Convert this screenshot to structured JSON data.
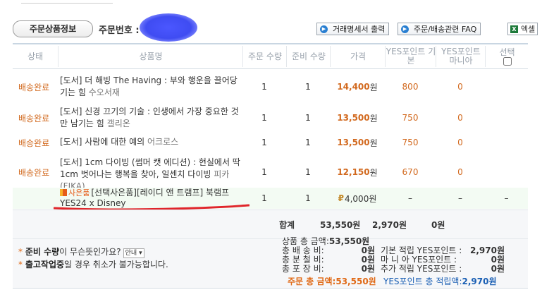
{
  "header": {
    "tab_label": "주문상품정보",
    "order_no_label": "주문번호 :",
    "btn_receipt": "거래명세서 출력",
    "btn_faq": "주문/배송관련 FAQ",
    "btn_excel": "엑셀"
  },
  "table": {
    "columns": [
      "상태",
      "상품명",
      "주문 수량",
      "준비 수량",
      "가격",
      "YES포인트 기본",
      "YES포인트 마니아",
      "선택"
    ],
    "rows": [
      {
        "status": "배송완료",
        "title": "[도서] 더 해빙 The Having : 부와 행운을 끌어당기는 힘",
        "author": "수오서재",
        "qty": "1",
        "ready": "1",
        "price": "14,400",
        "unit": "원",
        "point": "800",
        "mania": "0"
      },
      {
        "status": "배송완료",
        "title": "[도서] 신경 끄기의 기술 : 인생에서 가장 중요한 것만 남기는 힘",
        "author": "갤리온",
        "qty": "1",
        "ready": "1",
        "price": "13,500",
        "unit": "원",
        "point": "750",
        "mania": "0"
      },
      {
        "status": "배송완료",
        "title": "[도서] 사람에 대한 예의",
        "author": "어크로스",
        "qty": "1",
        "ready": "1",
        "price": "13,500",
        "unit": "원",
        "point": "750",
        "mania": "0"
      },
      {
        "status": "배송완료",
        "title": "[도서] 1cm 다이빙 (썸머 캣 에디션) : 현실에서 딱 1cm 벗어나는 행복을 찾아, 일센치 다이빙",
        "author": "피카(FIKA)",
        "qty": "1",
        "ready": "1",
        "price": "12,150",
        "unit": "원",
        "point": "670",
        "mania": "0"
      }
    ],
    "gift": {
      "badge": "사은품",
      "title": "[선택사은품][레이디 앤 트램프] 북램프",
      "title2": "YES24 x Disney",
      "qty": "1",
      "ready": "1",
      "price": "4,000원",
      "point_mark": "₽",
      "point": "–",
      "mania": "–",
      "select": "–"
    }
  },
  "summary": {
    "label": "합계",
    "total": "53,550원",
    "point": "2,970원",
    "mania": "0원"
  },
  "notes": {
    "line1_bold": "준비 수량",
    "line1_rest": "이 무슨뜻인가요?",
    "line1_select": "안내",
    "line2_bold": "출고작업중",
    "line2_rest": "일 경우 취소가 불가능합니다."
  },
  "details": {
    "goods_label": "상품 총 금액:",
    "goods_value": "53,550원",
    "ship_label": "총 배 송 비:",
    "ship_value": "0원",
    "split_label": "총 분 철 비:",
    "split_value": "0원",
    "wrap_label": "총 포 장 비:",
    "wrap_value": "0원",
    "order_total_label": "주문 총 금액:",
    "order_total_value": "53,550원",
    "p_basic_label": "기본 적립 YES포인트 :",
    "p_basic_value": "2,970원",
    "p_mania_label": "마 니 아 YES포인트 :",
    "p_mania_value": "0원",
    "p_extra_label": "추가 적립 YES포인트 :",
    "p_extra_value": "0원",
    "p_total_label": "YES포인트 총 적립액:",
    "p_total_value": "2,970원"
  },
  "colors": {
    "accent": "#d2691e",
    "blue": "#1a5fb4",
    "underline": "#e0262a"
  }
}
